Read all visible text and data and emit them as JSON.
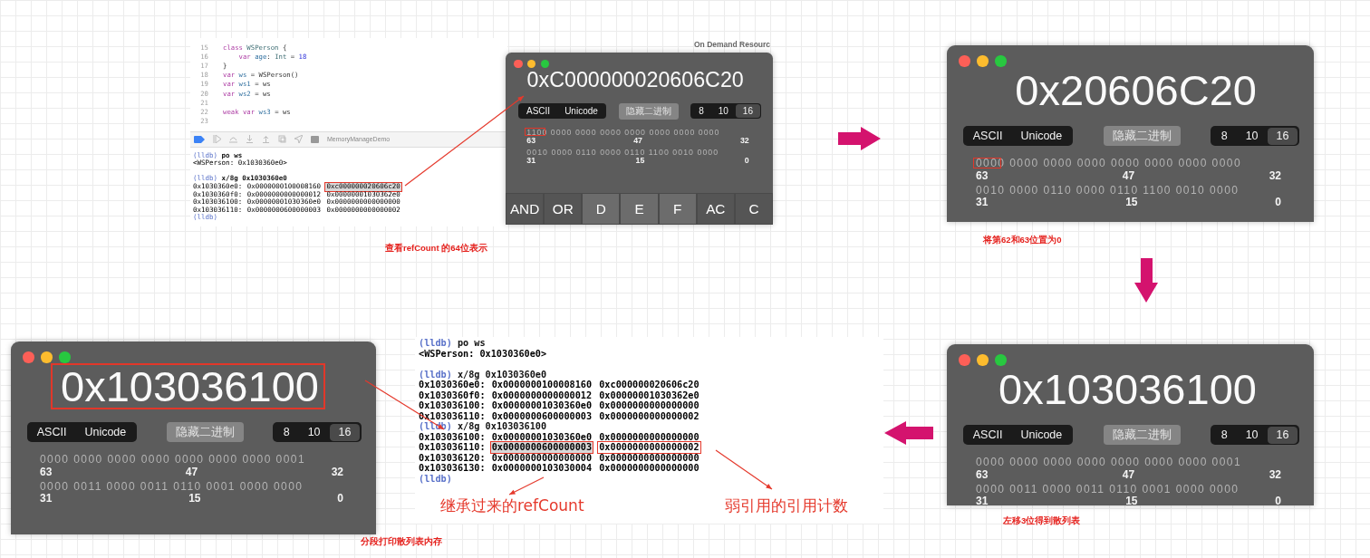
{
  "code_panel": {
    "lines": [
      {
        "number": "15",
        "tokens": [
          {
            "text": "class ",
            "kind": "keyword"
          },
          {
            "text": "WSPerson",
            "kind": "type"
          },
          {
            "text": " {",
            "kind": "plain"
          }
        ]
      },
      {
        "number": "16",
        "tokens": [
          {
            "text": "    var ",
            "kind": "keyword"
          },
          {
            "text": "age",
            "kind": "name"
          },
          {
            "text": ": ",
            "kind": "plain"
          },
          {
            "text": "Int",
            "kind": "type"
          },
          {
            "text": " = ",
            "kind": "plain"
          },
          {
            "text": "18",
            "kind": "number"
          }
        ]
      },
      {
        "number": "17",
        "tokens": [
          {
            "text": "}",
            "kind": "plain"
          }
        ]
      },
      {
        "number": "18",
        "tokens": [
          {
            "text": "var ",
            "kind": "keyword"
          },
          {
            "text": "ws",
            "kind": "name"
          },
          {
            "text": " = WSPerson()",
            "kind": "plain"
          }
        ]
      },
      {
        "number": "19",
        "tokens": [
          {
            "text": "var ",
            "kind": "keyword"
          },
          {
            "text": "ws1",
            "kind": "name"
          },
          {
            "text": " = ws",
            "kind": "plain"
          }
        ]
      },
      {
        "number": "20",
        "tokens": [
          {
            "text": "var ",
            "kind": "keyword"
          },
          {
            "text": "ws2",
            "kind": "name"
          },
          {
            "text": " = ws",
            "kind": "plain"
          }
        ]
      },
      {
        "number": "21"
      },
      {
        "number": "22",
        "tokens": [
          {
            "text": "weak var ",
            "kind": "keyword"
          },
          {
            "text": "ws3",
            "kind": "name"
          },
          {
            "text": " = ws",
            "kind": "plain"
          }
        ]
      },
      {
        "number": "23"
      }
    ],
    "scheme": "MemoryManageDemo",
    "console": [
      {
        "kind": "prompt",
        "prompt": "(lldb)",
        "command": "po ws"
      },
      {
        "kind": "text",
        "text": "<WSPerson: 0x1030360e0>"
      },
      {
        "kind": "gap"
      },
      {
        "kind": "prompt",
        "prompt": "(lldb)",
        "command": "x/8g 0x1030360e0"
      },
      {
        "kind": "memory",
        "address": "0x1030360e0:",
        "values": [
          {
            "text": "0x0000000100008160",
            "boxed": false,
            "shaded": false
          },
          {
            "text": "0xc000000020606c20",
            "boxed": true,
            "shaded": true
          }
        ]
      },
      {
        "kind": "memory",
        "address": "0x1030360f0:",
        "values": [
          {
            "text": "0x0000000000000012",
            "boxed": false,
            "shaded": false
          },
          {
            "text": "0x00000001030362e0",
            "boxed": false,
            "shaded": false
          }
        ]
      },
      {
        "kind": "memory",
        "address": "0x103036100:",
        "values": [
          {
            "text": "0x00000001030360e0",
            "boxed": false,
            "shaded": false
          },
          {
            "text": "0x0000000000000000",
            "boxed": false,
            "shaded": false
          }
        ]
      },
      {
        "kind": "memory",
        "address": "0x103036110:",
        "values": [
          {
            "text": "0x0000000600000003",
            "boxed": false,
            "shaded": false
          },
          {
            "text": "0x0000000000000002",
            "boxed": false,
            "shaded": false
          }
        ]
      },
      {
        "kind": "prompt",
        "prompt": "(lldb)"
      }
    ]
  },
  "background_window": {
    "title": "On Demand Resourc"
  },
  "calculators": [
    {
      "display": "0xC000000020606C20",
      "modes": [
        "ASCII",
        "Unicode"
      ],
      "hide_binary": "隐藏二进制",
      "bases": [
        {
          "label": "8",
          "selected": false
        },
        {
          "label": "10",
          "selected": false
        },
        {
          "label": "16",
          "selected": true
        }
      ],
      "display_boxed": false,
      "bits_boxed": true,
      "bit_rows": [
        {
          "bits": "1100 0000 0000 0000 0000 0000 0000 0000",
          "indices": [
            "63",
            "47",
            "32"
          ]
        },
        {
          "bits": "0010 0000 0110 0000 0110 1100 0010 0000",
          "indices": [
            "31",
            "15",
            "0"
          ]
        }
      ],
      "keys": [
        {
          "label": "AND",
          "kind": "operator"
        },
        {
          "label": "OR",
          "kind": "operator"
        },
        {
          "label": "D",
          "kind": "digit"
        },
        {
          "label": "E",
          "kind": "digit"
        },
        {
          "label": "F",
          "kind": "digit"
        },
        {
          "label": "AC",
          "kind": "operator"
        },
        {
          "label": "C",
          "kind": "operator"
        }
      ]
    },
    {
      "display": "0x20606C20",
      "modes": [
        "ASCII",
        "Unicode"
      ],
      "hide_binary": "隐藏二进制",
      "bases": [
        {
          "label": "8",
          "selected": false
        },
        {
          "label": "10",
          "selected": false
        },
        {
          "label": "16",
          "selected": true
        }
      ],
      "display_boxed": false,
      "bits_boxed": true,
      "bit_rows": [
        {
          "bits": "0000 0000 0000 0000 0000 0000 0000 0000",
          "indices": [
            "63",
            "47",
            "32"
          ]
        },
        {
          "bits": "0010 0000 0110 0000 0110 1100 0010 0000",
          "indices": [
            "31",
            "15",
            "0"
          ]
        }
      ]
    },
    {
      "display": "0x103036100",
      "modes": [
        "ASCII",
        "Unicode"
      ],
      "hide_binary": "隐藏二进制",
      "bases": [
        {
          "label": "8",
          "selected": false
        },
        {
          "label": "10",
          "selected": false
        },
        {
          "label": "16",
          "selected": true
        }
      ],
      "display_boxed": true,
      "bits_boxed": false,
      "bit_rows": [
        {
          "bits": "0000 0000 0000 0000 0000 0000 0000 0001",
          "indices": [
            "63",
            "47",
            "32"
          ]
        },
        {
          "bits": "0000 0011 0000 0011 0110 0001 0000 0000",
          "indices": [
            "31",
            "15",
            "0"
          ]
        }
      ]
    },
    {
      "display": "0x103036100",
      "modes": [
        "ASCII",
        "Unicode"
      ],
      "hide_binary": "隐藏二进制",
      "bases": [
        {
          "label": "8",
          "selected": false
        },
        {
          "label": "10",
          "selected": false
        },
        {
          "label": "16",
          "selected": true
        }
      ],
      "display_boxed": false,
      "bits_boxed": false,
      "bit_rows": [
        {
          "bits": "0000 0000 0000 0000 0000 0000 0000 0001",
          "indices": [
            "63",
            "47",
            "32"
          ]
        },
        {
          "bits": "0000 0011 0000 0011 0110 0001 0000 0000",
          "indices": [
            "31",
            "15",
            "0"
          ]
        }
      ]
    }
  ],
  "captions": [
    "查看refCount 的64位表示",
    "将第62和63位置为0",
    "分段打印散列表内存",
    "左移3位得到散列表"
  ],
  "lldb_panel": {
    "lines": [
      {
        "kind": "prompt",
        "prompt": "(lldb)",
        "command": "po ws"
      },
      {
        "kind": "text",
        "text": "<WSPerson: 0x1030360e0>"
      },
      {
        "kind": "gap"
      },
      {
        "kind": "prompt",
        "prompt": "(lldb)",
        "command": "x/8g 0x1030360e0"
      },
      {
        "kind": "memory",
        "address": "0x1030360e0:",
        "values": [
          {
            "text": "0x0000000100008160",
            "boxed": false,
            "shaded": false
          },
          {
            "text": "0xc000000020606c20",
            "boxed": false,
            "shaded": false
          }
        ]
      },
      {
        "kind": "memory",
        "address": "0x1030360f0:",
        "values": [
          {
            "text": "0x0000000000000012",
            "boxed": false,
            "shaded": false
          },
          {
            "text": "0x00000001030362e0",
            "boxed": false,
            "shaded": false
          }
        ]
      },
      {
        "kind": "memory",
        "address": "0x103036100:",
        "values": [
          {
            "text": "0x00000001030360e0",
            "boxed": false,
            "shaded": false
          },
          {
            "text": "0x0000000000000000",
            "boxed": false,
            "shaded": false
          }
        ]
      },
      {
        "kind": "memory",
        "address": "0x103036110:",
        "values": [
          {
            "text": "0x0000000600000003",
            "boxed": false,
            "shaded": false
          },
          {
            "text": "0x0000000000000002",
            "boxed": false,
            "shaded": false
          }
        ]
      },
      {
        "kind": "prompt",
        "prompt": "(lldb)",
        "command": "x/8g 0x103036100"
      },
      {
        "kind": "memory",
        "address": "0x103036100:",
        "values": [
          {
            "text": "0x00000001030360e0",
            "boxed": false,
            "shaded": false
          },
          {
            "text": "0x0000000000000000",
            "boxed": false,
            "shaded": false
          }
        ]
      },
      {
        "kind": "memory",
        "address": "0x103036110:",
        "values": [
          {
            "text": "0x0000000600000003",
            "boxed": true,
            "shaded": true
          },
          {
            "text": "0x0000000000000002",
            "boxed": true,
            "shaded": false
          }
        ]
      },
      {
        "kind": "memory",
        "address": "0x103036120:",
        "values": [
          {
            "text": "0x0000000000000000",
            "boxed": false,
            "shaded": false
          },
          {
            "text": "0x0000000000000000",
            "boxed": false,
            "shaded": false
          }
        ]
      },
      {
        "kind": "memory",
        "address": "0x103036130:",
        "values": [
          {
            "text": "0x0000000103030004",
            "boxed": false,
            "shaded": false
          },
          {
            "text": "0x0000000000000000",
            "boxed": false,
            "shaded": false
          }
        ]
      },
      {
        "kind": "prompt",
        "prompt": "(lldb)"
      }
    ],
    "notes": [
      "继承过来的refCount",
      "弱引用的引用计数"
    ]
  }
}
